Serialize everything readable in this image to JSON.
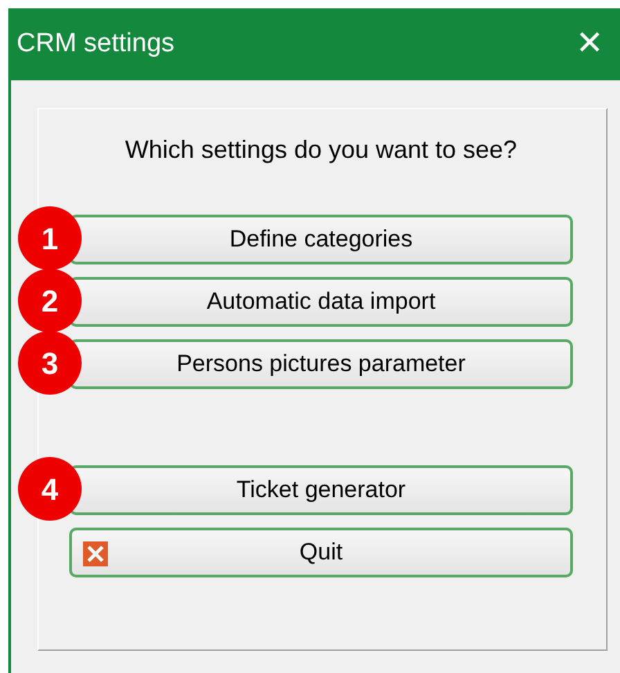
{
  "window": {
    "title": "CRM settings",
    "close": "✕"
  },
  "prompt": "Which settings do you want to see?",
  "button_groups": [
    [
      {
        "kind": "numbered",
        "badge": "1",
        "label": "Define categories"
      },
      {
        "kind": "numbered",
        "badge": "2",
        "label": "Automatic data import"
      },
      {
        "kind": "numbered",
        "badge": "3",
        "label": "Persons pictures parameter"
      }
    ],
    [
      {
        "kind": "numbered",
        "badge": "4",
        "label": "Ticket generator"
      },
      {
        "kind": "quit",
        "label": "Quit"
      }
    ]
  ]
}
